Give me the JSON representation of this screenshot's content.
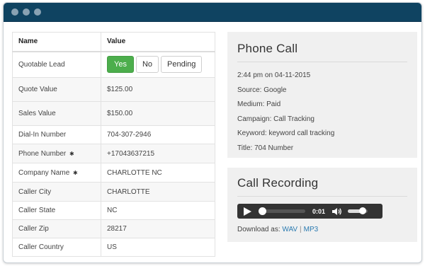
{
  "table": {
    "headers": {
      "name": "Name",
      "value": "Value"
    },
    "quotable_lead": {
      "label": "Quotable Lead",
      "buttons": {
        "yes": "Yes",
        "no": "No",
        "pending": "Pending"
      },
      "selected": "Yes"
    },
    "rows": [
      {
        "label": "Quote Value",
        "value": "$125.00"
      },
      {
        "label": "Sales Value",
        "value": "$150.00"
      },
      {
        "label": "Dial-In Number",
        "value": "704-307-2946"
      },
      {
        "label": "Phone Number",
        "value": "+17043637215",
        "required_mark": "✱"
      },
      {
        "label": "Company Name",
        "value": "CHARLOTTE NC",
        "required_mark": "✱"
      },
      {
        "label": "Caller City",
        "value": "CHARLOTTE"
      },
      {
        "label": "Caller State",
        "value": "NC"
      },
      {
        "label": "Caller Zip",
        "value": "28217"
      },
      {
        "label": "Caller Country",
        "value": "US"
      }
    ]
  },
  "phone_call": {
    "title": "Phone Call",
    "lines": [
      "2:44 pm on 04-11-2015",
      "Source: Google",
      "Medium: Paid",
      "Campaign: Call Tracking",
      "Keyword: keyword call tracking",
      "Title: 704 Number"
    ]
  },
  "call_recording": {
    "title": "Call Recording",
    "player": {
      "time": "0:01",
      "progress": 0.0,
      "volume": 0.75,
      "icons": {
        "play": "play-icon",
        "volume": "volume-icon"
      }
    },
    "download_label": "Download as:",
    "formats": [
      "WAV",
      "MP3"
    ],
    "separator": "|"
  },
  "colors": {
    "titlebar": "#0f4361",
    "yes_button": "#4cae4c",
    "panel_bg": "#f0f0f0",
    "link": "#2a7ab0"
  }
}
